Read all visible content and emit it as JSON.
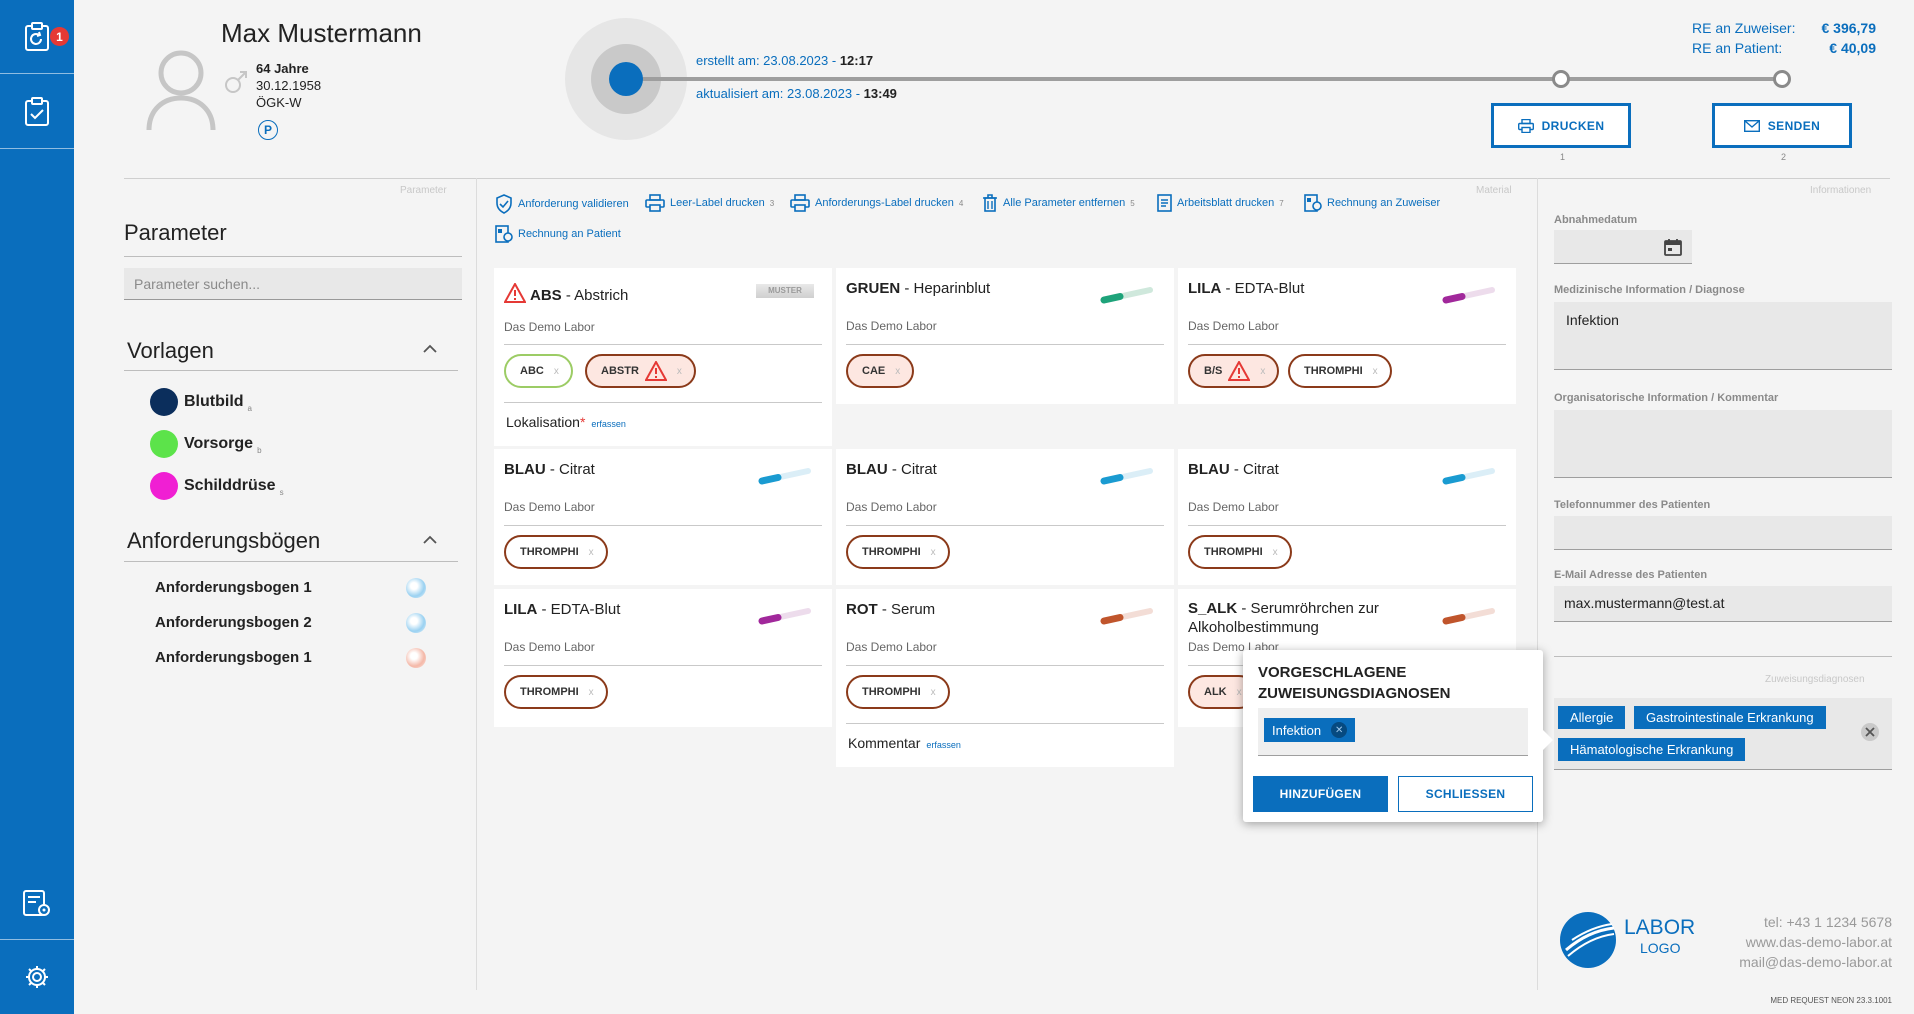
{
  "sidebar": {
    "badge": "1"
  },
  "patient": {
    "name": "Max Mustermann",
    "age": "64 Jahre",
    "dob": "30.12.1958",
    "insurance": "ÖGK-W",
    "badge": "P"
  },
  "progress": {
    "created_label": "erstellt am: 23.08.2023 - ",
    "created_time": "12:17",
    "updated_label": "aktualisiert am: 23.08.2023 - ",
    "updated_time": "13:49"
  },
  "invoice": {
    "zuweiser_label": "RE an Zuweiser:",
    "zuweiser_value": "€  396,79",
    "patient_label": "RE an Patient:",
    "patient_value": "€    40,09"
  },
  "actions": {
    "print_label": "DRUCKEN",
    "print_step": "1",
    "send_label": "SENDEN",
    "send_step": "2"
  },
  "left": {
    "caption": "Parameter",
    "title": "Parameter",
    "search_placeholder": "Parameter suchen...",
    "templates_title": "Vorlagen",
    "templates": [
      {
        "label": "Blutbild",
        "key": "a",
        "color": "#0b2e5c"
      },
      {
        "label": "Vorsorge",
        "key": "b",
        "color": "#5ce34a"
      },
      {
        "label": "Schilddrüse",
        "key": "s",
        "color": "#f01fd3"
      }
    ],
    "forms_title": "Anforderungsbögen",
    "forms": [
      {
        "label": "Anforderungsbogen 1"
      },
      {
        "label": "Anforderungsbogen 2"
      },
      {
        "label": "Anforderungsbogen 1"
      }
    ]
  },
  "middle": {
    "caption": "Material",
    "toolbar": [
      {
        "label": "Anforderung validieren",
        "num": "",
        "icon": "shield-check-icon"
      },
      {
        "label": "Leer-Label drucken",
        "num": "3",
        "icon": "printer-icon"
      },
      {
        "label": "Anforderungs-Label drucken",
        "num": "4",
        "icon": "printer-icon"
      },
      {
        "label": "Alle Parameter entfernen",
        "num": "5",
        "icon": "trash-icon"
      },
      {
        "label": "Arbeitsblatt drucken",
        "num": "7",
        "icon": "document-icon"
      },
      {
        "label": "Rechnung an Zuweiser",
        "num": "",
        "icon": "invoice-icon"
      },
      {
        "label": "Rechnung an Patient",
        "num": "",
        "icon": "invoice-icon"
      }
    ],
    "cards": [
      {
        "code": "ABS",
        "name": " - Abstrich",
        "lab": "Das Demo Labor",
        "chips": [
          "ABC",
          "ABSTR"
        ],
        "extra_label": "Lokalisation",
        "extra_link": "erfassen"
      },
      {
        "code": "GRUEN",
        "name": " - Heparinblut",
        "lab": "Das Demo Labor",
        "chips": [
          "CAE"
        ]
      },
      {
        "code": "LILA",
        "name": " - EDTA-Blut",
        "lab": "Das Demo Labor",
        "chips": [
          "B/S",
          "THROMPHI"
        ]
      },
      {
        "code": "BLAU",
        "name": " - Citrat",
        "lab": "Das Demo Labor",
        "chips": [
          "THROMPHI"
        ]
      },
      {
        "code": "BLAU",
        "name": " - Citrat",
        "lab": "Das Demo Labor",
        "chips": [
          "THROMPHI"
        ]
      },
      {
        "code": "BLAU",
        "name": " - Citrat",
        "lab": "Das Demo Labor",
        "chips": [
          "THROMPHI"
        ]
      },
      {
        "code": "LILA",
        "name": " - EDTA-Blut",
        "lab": "Das Demo Labor",
        "chips": [
          "THROMPHI"
        ]
      },
      {
        "code": "ROT",
        "name": " - Serum",
        "lab": "Das Demo Labor",
        "chips": [
          "THROMPHI"
        ],
        "extra_label": "Kommentar",
        "extra_link": "erfassen"
      },
      {
        "code": "S_ALK",
        "name": " - Serumröhrchen zur",
        "name2": "Alkoholbestimmung",
        "lab": "Das Demo Labor",
        "chips": [
          "ALK"
        ]
      }
    ],
    "tube_muster": "MUSTER"
  },
  "right": {
    "caption": "Informationen",
    "abnahme_label": "Abnahmedatum",
    "med_label": "Medizinische Information / Diagnose",
    "med_value": "Infektion",
    "org_label": "Organisatorische Information / Kommentar",
    "tel_label": "Telefonnummer des Patienten",
    "email_label": "E-Mail Adresse des Patienten",
    "email_value": "max.mustermann@test.at",
    "diag_caption": "Zuweisungsdiagnosen",
    "diagnoses": [
      "Allergie",
      "Gastrointestinale Erkrankung",
      "Hämatologische Erkrankung"
    ]
  },
  "dialog": {
    "title_line1": "VORGESCHLAGENE",
    "title_line2": "ZUWEISUNGSDIAGNOSEN",
    "chip": "Infektion",
    "add_label": "HINZUFÜGEN",
    "close_label": "SCHLIESSEN"
  },
  "footer": {
    "logo_line1": "LABOR",
    "logo_line2": "LOGO",
    "tel": "tel: +43 1 1234 5678",
    "web": "www.das-demo-labor.at",
    "mail": "mail@das-demo-labor.at",
    "version": "MED REQUEST NEON 23.3.1001"
  },
  "colors": {
    "primary": "#0a6ebd",
    "chip_border": "#8b3a1a",
    "warning": "#e53935"
  }
}
